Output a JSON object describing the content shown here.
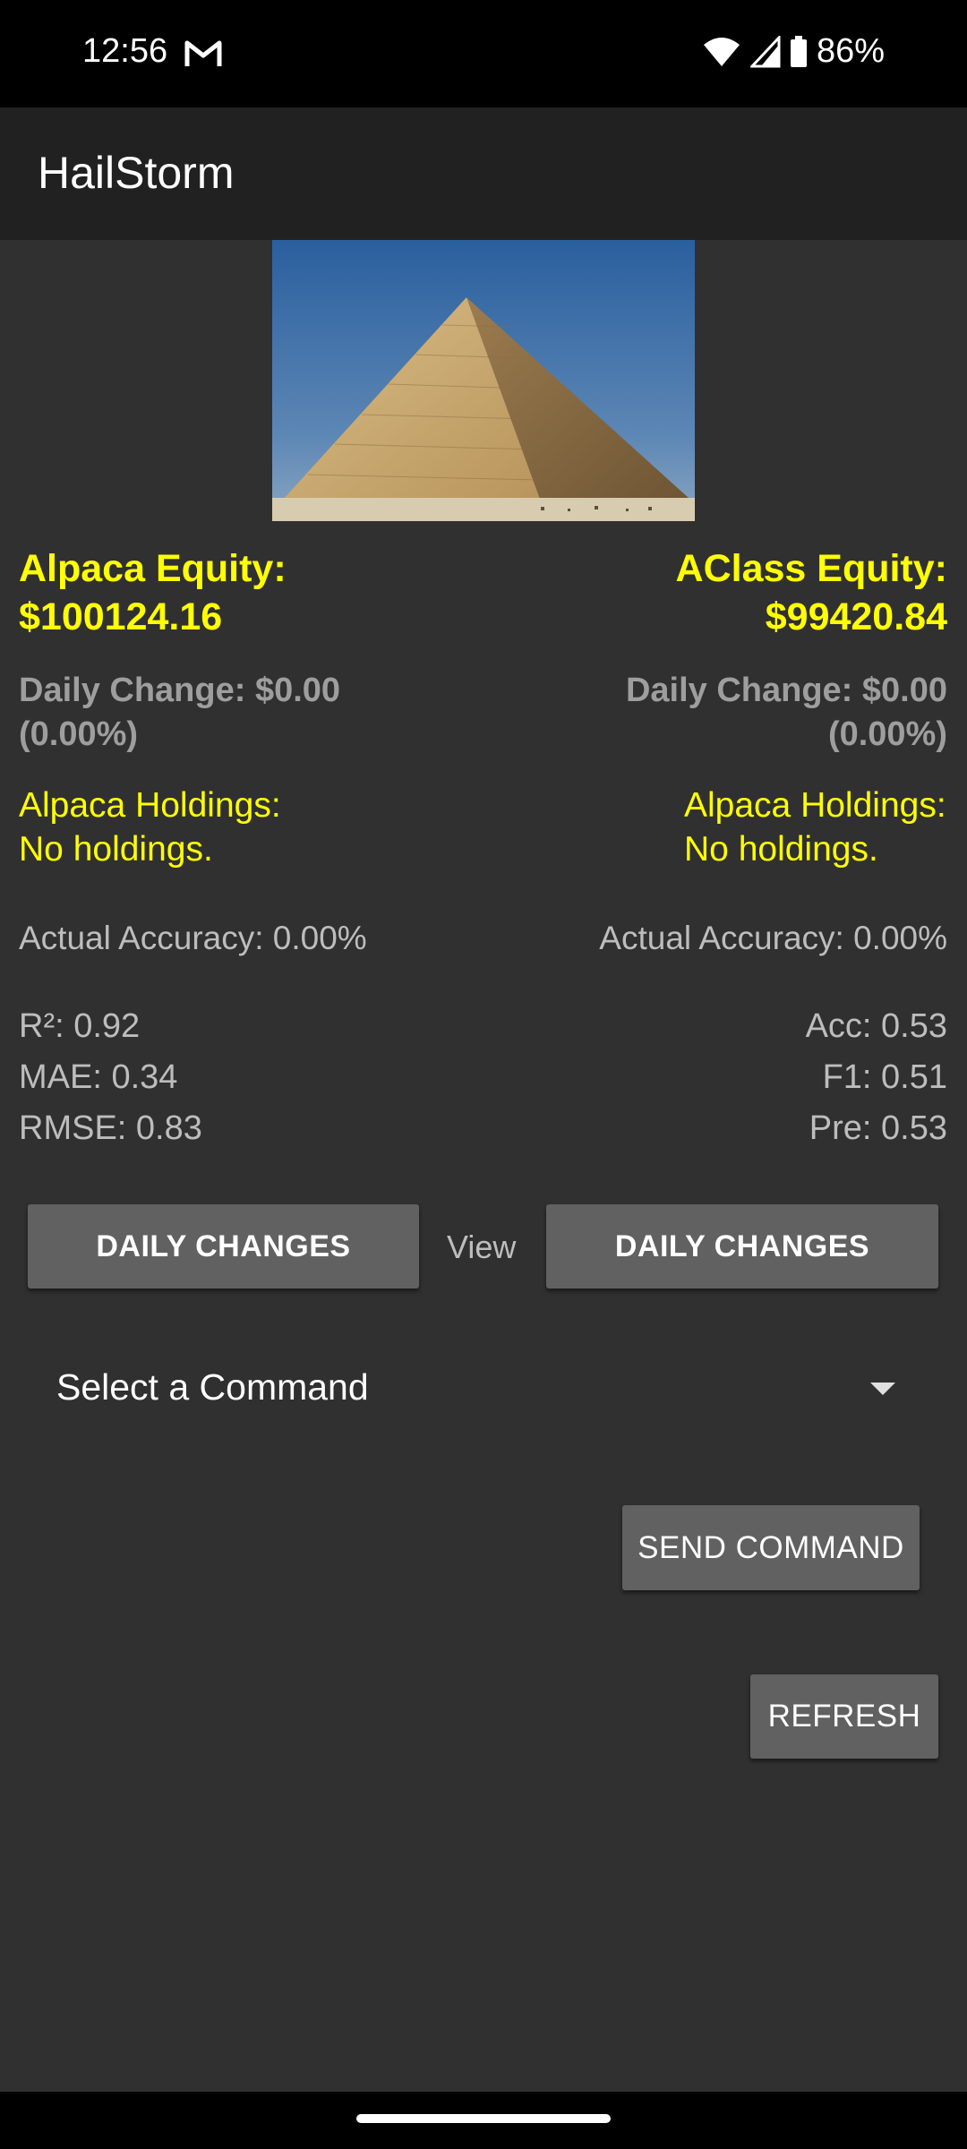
{
  "status_bar": {
    "time": "12:56",
    "battery": "86%",
    "icons": [
      "gmail-icon",
      "wifi-icon",
      "signal-icon",
      "battery-icon"
    ]
  },
  "app_bar": {
    "title": "HailStorm"
  },
  "left_panel": {
    "equity_label": "Alpaca Equity:",
    "equity_value": "$100124.16",
    "daily_change_line1": "Daily Change: $0.00",
    "daily_change_line2": "(0.00%)",
    "holdings_label": "Alpaca Holdings:",
    "holdings_value": "No holdings.",
    "accuracy": "Actual Accuracy: 0.00%",
    "metrics": [
      "R²: 0.92",
      "MAE: 0.34",
      "RMSE: 0.83"
    ]
  },
  "right_panel": {
    "equity_label": "AClass Equity:",
    "equity_value": "$99420.84",
    "daily_change_line1": "Daily Change: $0.00",
    "daily_change_line2": "(0.00%)",
    "holdings_label": "Alpaca Holdings:",
    "holdings_value": "No holdings.",
    "accuracy": "Actual Accuracy: 0.00%",
    "metrics": [
      "Acc: 0.53",
      "F1: 0.51",
      "Pre: 0.53"
    ]
  },
  "view_row": {
    "left_button": "DAILY CHANGES",
    "label": "View",
    "right_button": "DAILY CHANGES"
  },
  "command": {
    "spinner_value": "Select a Command",
    "send_button": "SEND COMMAND",
    "refresh_button": "REFRESH"
  },
  "colors": {
    "background": "#303030",
    "app_bar": "#212121",
    "accent_yellow": "#ffff00",
    "button": "#616161"
  }
}
